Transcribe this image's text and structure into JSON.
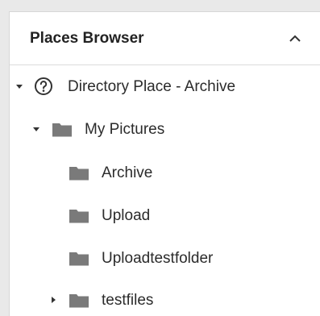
{
  "panel": {
    "title": "Places Browser",
    "collapse_icon": "chevron-up-icon"
  },
  "tree": {
    "root": {
      "label": "Directory Place - Archive",
      "icon": "question-circle-icon",
      "expanded": true
    },
    "my_pictures": {
      "label": "My Pictures",
      "icon": "folder-icon",
      "expanded": true
    },
    "children": [
      {
        "label": "Archive",
        "icon": "folder-icon"
      },
      {
        "label": "Upload",
        "icon": "folder-icon"
      },
      {
        "label": "Uploadtestfolder",
        "icon": "folder-icon"
      },
      {
        "label": "testfiles",
        "icon": "folder-icon",
        "expanded": false
      }
    ]
  },
  "colors": {
    "folder": "#7a7a7a",
    "text": "#2b2b2b",
    "border": "#d7d7d7"
  }
}
